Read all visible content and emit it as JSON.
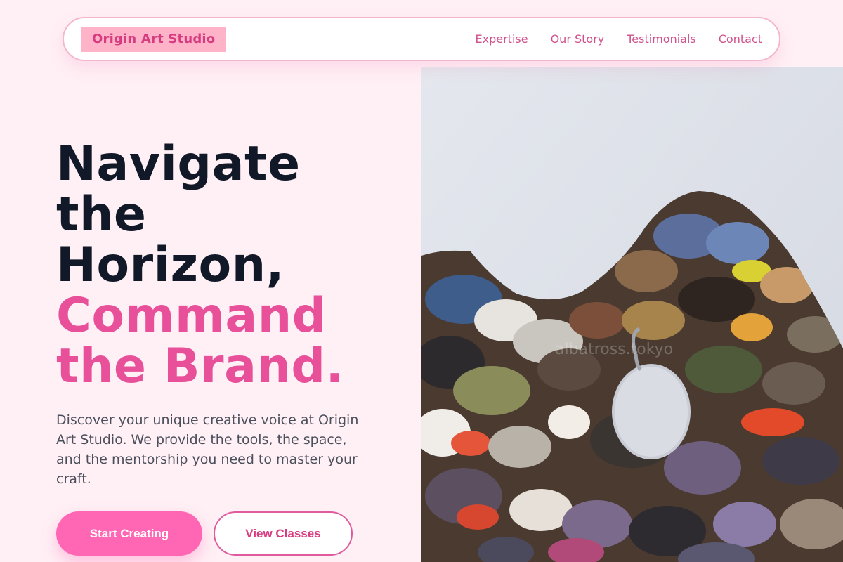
{
  "brand": {
    "name": "Origin Art Studio"
  },
  "nav": {
    "links": [
      "Expertise",
      "Our Story",
      "Testimonials",
      "Contact"
    ]
  },
  "hero": {
    "title_line1": "Navigate",
    "title_line2": "the",
    "title_line3": "Horizon,",
    "title_accent_line1": "Command",
    "title_accent_line2": "the Brand.",
    "description": "Discover your unique creative voice at Origin Art Studio. We provide the tools, the space, and the mentorship you need to master your craft.",
    "primary_cta": "Start Creating",
    "secondary_cta": "View Classes",
    "image_alt": "paint palette",
    "watermark": "albatross.tokyo"
  },
  "colors": {
    "page_bg": "#fff0f5",
    "accent_pink": "#e8509a",
    "button_pink": "#ff66b3",
    "brand_badge_bg": "#ffb3c9",
    "heading_dark": "#111827",
    "body_text": "#4b4f5c"
  }
}
